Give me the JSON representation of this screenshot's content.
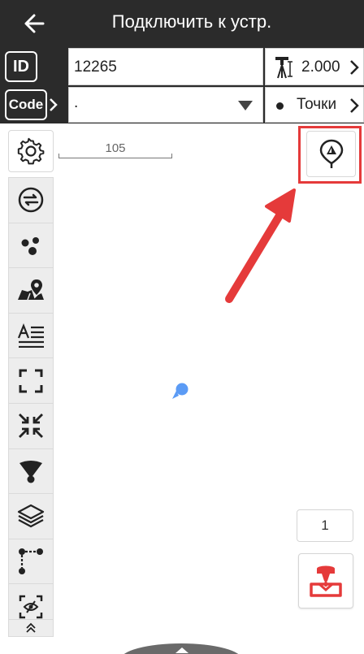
{
  "header": {
    "title": "Подключить к устр.",
    "back_icon": "arrow-left-icon"
  },
  "id_row": {
    "badge_label": "ID",
    "value": "12265",
    "height_icon": "pole-height-icon",
    "height_value": "2.000"
  },
  "code_row": {
    "badge_label": "Code",
    "value": ".",
    "points_label": "Точки"
  },
  "toolbar": {
    "items": [
      {
        "name": "settings-icon"
      },
      {
        "name": "swap-icon"
      },
      {
        "name": "points-cluster-icon"
      },
      {
        "name": "map-pin-icon"
      },
      {
        "name": "text-lines-icon"
      },
      {
        "name": "full-extent-icon"
      },
      {
        "name": "shrink-icon"
      },
      {
        "name": "signal-cone-icon"
      },
      {
        "name": "layers-icon"
      },
      {
        "name": "polyline-icon"
      },
      {
        "name": "hide-icon"
      },
      {
        "name": "collapse-up-icon"
      }
    ]
  },
  "map": {
    "scale_label": "105",
    "locate_icon": "gps-locate-icon",
    "counter": "1",
    "survey_icon": "survey-point-icon"
  },
  "colors": {
    "header_bg": "#2b2b2b",
    "highlight": "#e53a3a",
    "location_dot": "#5b9bf5",
    "survey_red": "#e53a3a"
  }
}
